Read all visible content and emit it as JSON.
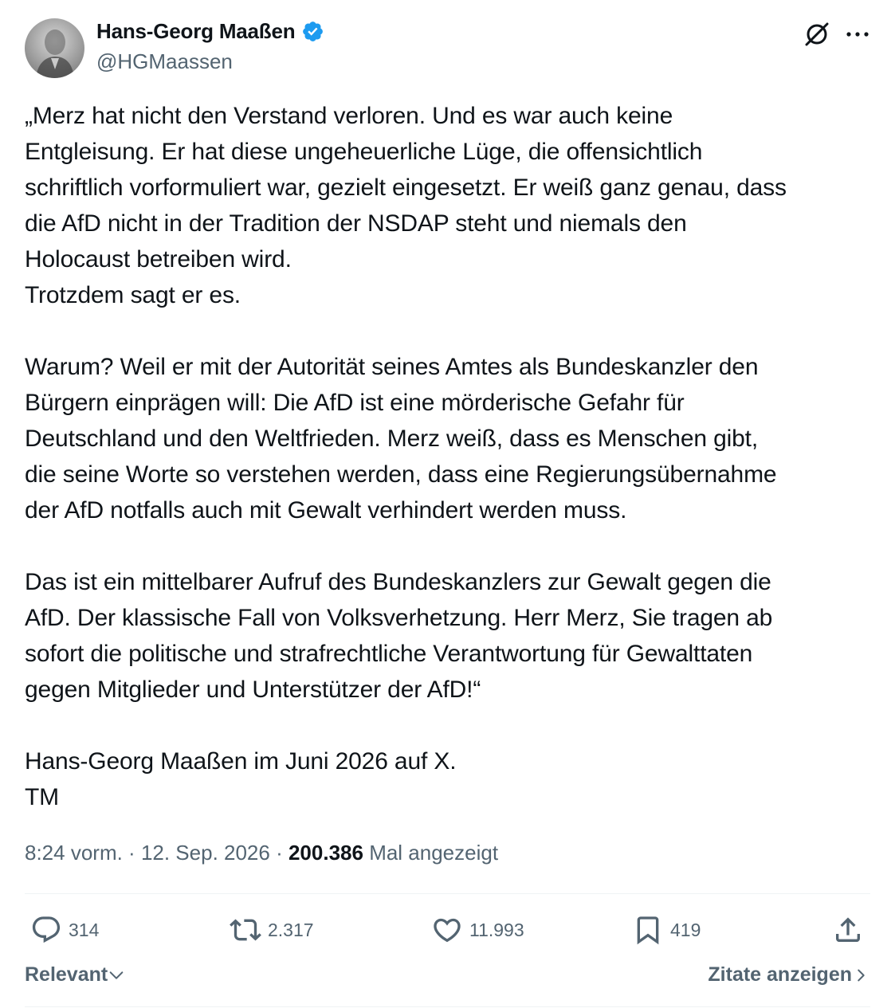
{
  "author": {
    "display_name": "Hans-Georg Maaßen",
    "handle": "@HGMaassen",
    "verified": true,
    "avatar_icon": "profile-photo"
  },
  "header_icons": [
    "grok-icon",
    "more-icon"
  ],
  "tweet": {
    "lines": [
      "„Merz hat nicht den Verstand verloren. Und es war auch keine",
      "Entgleisung. Er hat diese ungeheuerliche Lüge, die offensichtlich",
      "schriftlich vorformuliert war, gezielt eingesetzt. Er weiß ganz genau, dass",
      "die AfD nicht in der Tradition der NSDAP steht und niemals den",
      "Holocaust betreiben wird.",
      "Trotzdem sagt er es.",
      "",
      "Warum? Weil er mit der Autorität seines Amtes als Bundeskanzler den",
      "Bürgern einprägen will: Die AfD ist eine mörderische Gefahr für",
      "Deutschland und den Weltfrieden. Merz weiß, dass es Menschen gibt,",
      "die seine Worte so verstehen werden, dass eine Regierungsübernahme",
      "der AfD notfalls auch mit Gewalt verhindert werden muss.",
      "",
      "Das ist ein mittelbarer Aufruf des Bundeskanzlers zur Gewalt gegen die",
      "AfD. Der klassische Fall von Volksverhetzung. Herr Merz, Sie tragen ab",
      "sofort die politische und strafrechtliche Verantwortung für Gewalttaten",
      "gegen Mitglieder und Unterstützer der AfD!“",
      "",
      "Hans-Georg Maaßen im Juni 2026 auf X.",
      "TM"
    ]
  },
  "meta": {
    "time": "8:24 vorm.",
    "separator": " · ",
    "date": "12. Sep. 2026",
    "views_count": "200.386",
    "views_label": "Mal angezeigt"
  },
  "actions": {
    "replies": {
      "icon": "reply-icon",
      "count": "314"
    },
    "reposts": {
      "icon": "repost-icon",
      "count": "2.317"
    },
    "likes": {
      "icon": "like-icon",
      "count": "11.993"
    },
    "bookmarks": {
      "icon": "bookmark-icon",
      "count": "419"
    },
    "share": {
      "icon": "share-icon"
    }
  },
  "footer": {
    "sort_label": "Relevant",
    "quotes_label": "Zitate anzeigen"
  },
  "colors": {
    "text": "#0f1419",
    "secondary": "#536471",
    "verified": "#1d9bf0",
    "divider": "#eff3f4"
  }
}
